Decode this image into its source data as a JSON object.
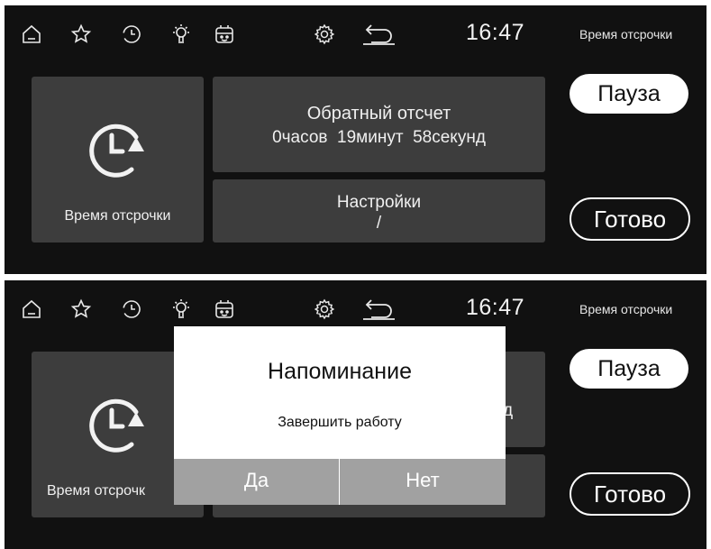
{
  "status_bar": {
    "time": "16:47",
    "title": "Время отсрочки",
    "icons": [
      "home-icon",
      "star-icon",
      "history-clock-icon",
      "light-bulb-icon",
      "robot-face-icon",
      "settings-gear-icon",
      "back-arrow-icon"
    ]
  },
  "delay_card": {
    "label": "Время отсрочки",
    "icon": "delay-timer-icon"
  },
  "countdown": {
    "title": "Обратный отсчет",
    "value": "0часов  19минут  58секунд"
  },
  "settings": {
    "title": "Настройки",
    "value": "/"
  },
  "buttons": {
    "pause": "Пауза",
    "done": "Готово"
  },
  "reminder_dialog": {
    "title": "Напоминание",
    "message": "Завершить работу",
    "yes": "Да",
    "no": "Нет",
    "left_card_visible_label": "Время отсрочк",
    "countdown_peek": "д"
  },
  "colors": {
    "background": "#111111",
    "card": "#3d3d3d",
    "dialog_buttons": "#a1a1a1",
    "text": "#f0f0f0"
  }
}
